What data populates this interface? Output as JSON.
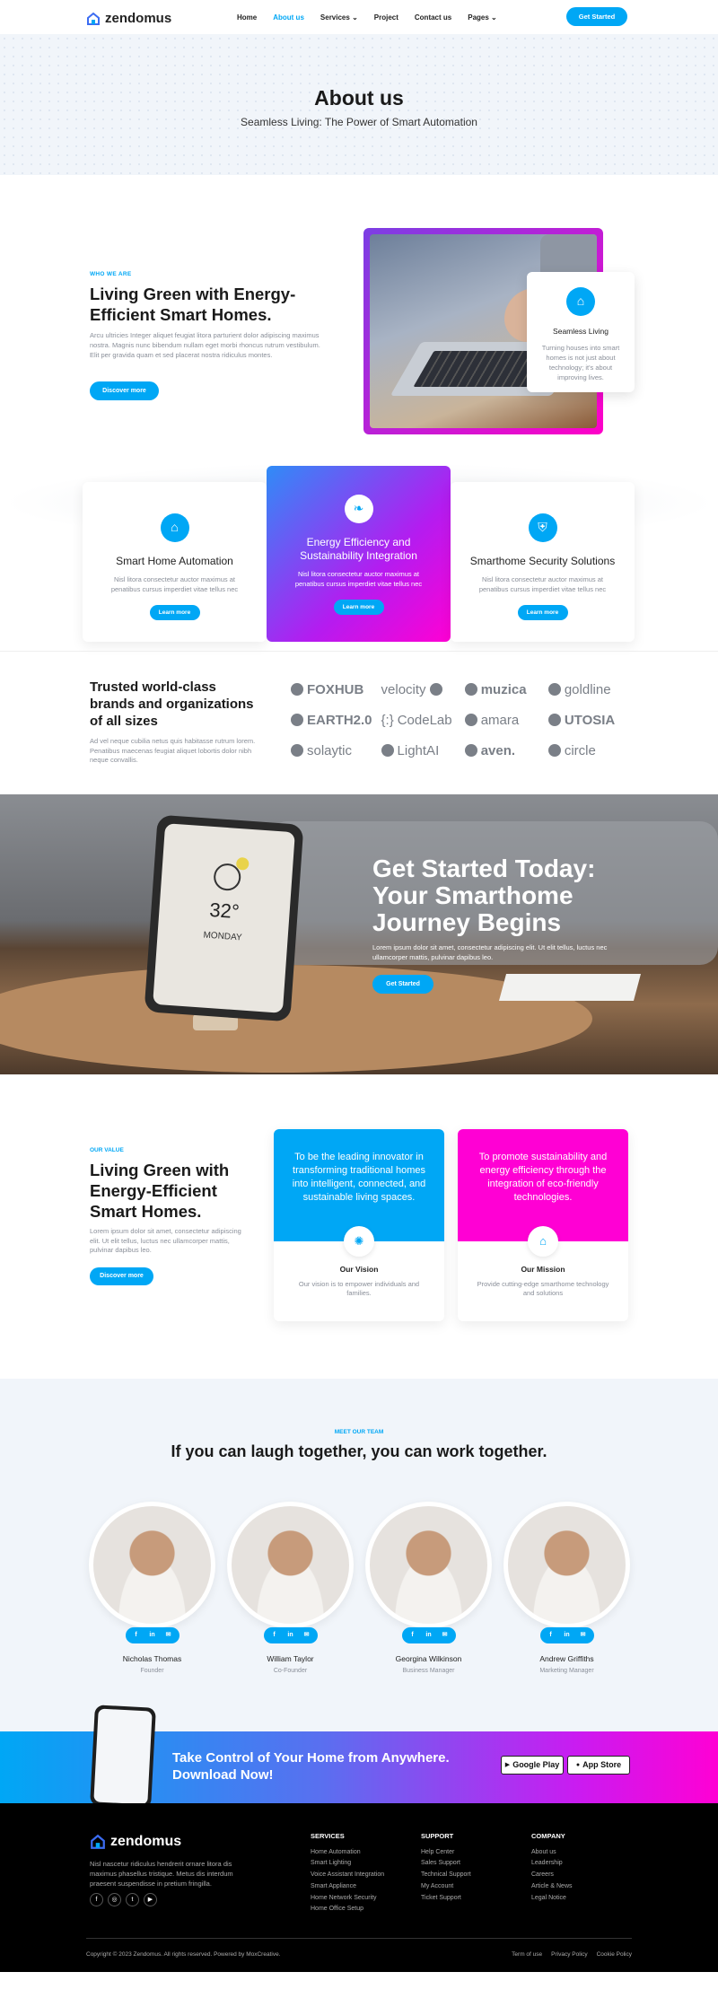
{
  "brand": {
    "name": "zendomus",
    "accent": "#00a7f5",
    "magenta": "#ff00d4"
  },
  "nav": {
    "items": [
      {
        "label": "Home"
      },
      {
        "label": "About us",
        "active": true
      },
      {
        "label": "Services"
      },
      {
        "label": "Project"
      },
      {
        "label": "Contact us"
      },
      {
        "label": "Pages"
      }
    ],
    "cta": "Get Started"
  },
  "hero": {
    "title": "About us",
    "subtitle": "Seamless Living: The Power of Smart Automation"
  },
  "about": {
    "tag": "WHO WE ARE",
    "title": "Living Green with Energy-Efficient Smart Homes.",
    "description": "Arcu ultricies Integer aliquet feugiat litora parturient dolor adipiscing maximus nostra. Magnis nunc bibendum nullam eget morbi rhoncus rutrum vestibulum. Elit per gravida quam et sed placerat nostra ridiculus montes.",
    "button": "Discover more",
    "card": {
      "title": "Seamless Living",
      "text": "Turning houses into smart homes is not just about technology; it's about improving lives."
    }
  },
  "features": [
    {
      "title": "Smart Home Automation",
      "text": "Nisl litora consectetur auctor maximus at penatibus cursus imperdiet vitae tellus nec",
      "button": "Learn more",
      "icon": "home-gear-icon"
    },
    {
      "title": "Energy Efficiency and Sustainability Integration",
      "text": "Nisl litora consectetur auctor maximus at penatibus cursus imperdiet vitae tellus nec",
      "button": "Learn more",
      "icon": "leaf-icon"
    },
    {
      "title": "Smarthome Security Solutions",
      "text": "Nisl litora consectetur auctor maximus at penatibus cursus imperdiet vitae tellus nec",
      "button": "Learn more",
      "icon": "shield-icon"
    }
  ],
  "brands": {
    "title": "Trusted world-class brands and organizations of all sizes",
    "text": "Ad vel neque cubilia netus quis habitasse rutrum lorem. Penatibus maecenas feugiat aliquet lobortis dolor nibh neque convallis.",
    "logos": [
      "FOXHUB",
      "velocity",
      "muzica",
      "goldline",
      "EARTH2.0",
      "CodeLab",
      "amara",
      "UTOSIA",
      "solaytic",
      "LightAI",
      "aven.",
      "circle"
    ]
  },
  "cta": {
    "title": "Get Started Today: Your Smarthome Journey Begins",
    "text": "Lorem ipsum dolor sit amet, consectetur adipiscing elit. Ut elit tellus, luctus nec ullamcorper mattis, pulvinar dapibus leo.",
    "button": "Get Started",
    "tablet": {
      "temp": "32°",
      "day": "MONDAY"
    }
  },
  "value": {
    "tag": "OUR VALUE",
    "title": "Living Green with Energy-Efficient Smart Homes.",
    "description": "Lorem ipsum dolor sit amet, consectetur adipiscing elit. Ut elit tellus, luctus nec ullamcorper mattis, pulvinar dapibus leo.",
    "button": "Discover more",
    "cards": [
      {
        "statement": "To be the leading innovator in transforming traditional homes into intelligent, connected, and sustainable living spaces.",
        "title": "Our Vision",
        "text": "Our vision is to empower individuals and families.",
        "color": "#00a7f5"
      },
      {
        "statement": "To promote sustainability and energy efficiency through the integration of eco-friendly technologies.",
        "title": "Our Mission",
        "text": "Provide cutting-edge smarthome technology and solutions",
        "color": "#ff00d4"
      }
    ]
  },
  "team": {
    "tag": "MEET OUR TEAM",
    "title": "If you can laugh together, you can work together.",
    "members": [
      {
        "name": "Nicholas Thomas",
        "role": "Founder"
      },
      {
        "name": "William Taylor",
        "role": "Co-Founder"
      },
      {
        "name": "Georgina Wilkinson",
        "role": "Business Manager"
      },
      {
        "name": "Andrew Griffiths",
        "role": "Marketing Manager"
      }
    ]
  },
  "app": {
    "title": "Take Control of Your Home from Anywhere. Download Now!",
    "google": "Google Play",
    "apple": "App Store"
  },
  "footer": {
    "about": "Nisl nascetur ridiculus hendrerit ornare litora dis maximus phasellus tristique. Metus dis interdum praesent suspendisse in pretium fringilla.",
    "columns": [
      {
        "title": "SERVICES",
        "links": [
          "Home Automation",
          "Smart Lighting",
          "Voice Assistant Integration",
          "Smart Appliance",
          "Home Network Security",
          "Home Office Setup"
        ]
      },
      {
        "title": "SUPPORT",
        "links": [
          "Help Center",
          "Sales Support",
          "Technical Support",
          "My Account",
          "Ticket Support"
        ]
      },
      {
        "title": "COMPANY",
        "links": [
          "About us",
          "Leadership",
          "Careers",
          "Article & News",
          "Legal Notice"
        ]
      }
    ],
    "copyright": "Copyright © 2023 Zendomus. All rights reserved. Powered by MoxCreative.",
    "legal": [
      "Term of use",
      "Privacy Policy",
      "Cookie Policy"
    ]
  }
}
